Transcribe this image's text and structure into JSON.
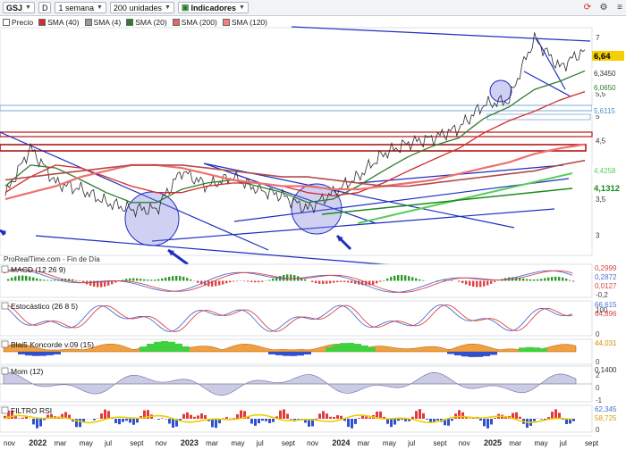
{
  "toolbar": {
    "ticker": "GSJ",
    "period_button": "D",
    "timeframe": "1 semana",
    "units": "200 unidades",
    "indicators_label": "Indicadores"
  },
  "legend": [
    {
      "label": "Precio",
      "color": "#ffffff"
    },
    {
      "label": "SMA (40)",
      "color": "#d42b2b"
    },
    {
      "label": "SMA (4)",
      "color": "#9a9a9a"
    },
    {
      "label": "SMA (20)",
      "color": "#2f7d2f"
    },
    {
      "label": "SMA (200)",
      "color": "#d96b6b"
    },
    {
      "label": "SMA (120)",
      "color": "#f08080"
    }
  ],
  "price_axis": {
    "ticks": [
      "7",
      "6,5",
      "6",
      "5,5",
      "5",
      "4,5",
      "4",
      "3,5",
      "3"
    ],
    "badges": [
      {
        "text": "6,64",
        "bg": "#f4d000",
        "fg": "#000000",
        "bold": true
      },
      {
        "text": "6,3450",
        "bg": "#ffffff",
        "fg": "#333333",
        "bold": false
      },
      {
        "text": "6,0650",
        "bg": "#ffffff",
        "fg": "#2f7d2f",
        "bold": false
      },
      {
        "text": "5,6115",
        "bg": "#ffffff",
        "fg": "#4d8fd0",
        "bold": false
      },
      {
        "text": "4,4258",
        "bg": "#ffffff",
        "fg": "#5ccc5c",
        "bold": false
      },
      {
        "text": "4,1312",
        "bg": "#ffffff",
        "fg": "#1a8a1a",
        "bold": true
      }
    ]
  },
  "watermark": "ProRealTime.com - Fin de Día",
  "x_axis": {
    "labels": [
      "nov",
      "2022",
      "mar",
      "may",
      "jul",
      "sept",
      "nov",
      "2023",
      "mar",
      "may",
      "jul",
      "sept",
      "nov",
      "2024",
      "mar",
      "may",
      "jul",
      "sept",
      "nov",
      "2025",
      "mar",
      "may",
      "jul",
      "sept"
    ],
    "bold": [
      "2022",
      "2023",
      "2024",
      "2025"
    ]
  },
  "panels": [
    {
      "key": "macd",
      "title": "MACD (12 26 9)",
      "values": [
        "0,2999",
        "0,2872",
        "0,0127"
      ],
      "value_colors": [
        "#d44",
        "#4a6fd0",
        "#d44"
      ],
      "ticks": [
        "-0,2"
      ]
    },
    {
      "key": "stoch",
      "title": "Estocástico (26 8 5)",
      "values": [
        "66,615",
        "64,896"
      ],
      "value_colors": [
        "#4a6fd0",
        "#d44"
      ],
      "ticks": [
        "100",
        "0"
      ]
    },
    {
      "key": "blai5",
      "title": "Blai5 Koncorde v.09 (15)",
      "values": [
        "44,031"
      ],
      "value_colors": [
        "#d88a00"
      ],
      "ticks": [
        "0"
      ]
    },
    {
      "key": "mom",
      "title": "Mom (12)",
      "values": [
        "0,1400"
      ],
      "value_colors": [
        "#333333"
      ],
      "ticks": [
        "2",
        "0",
        "-1"
      ]
    },
    {
      "key": "rsi",
      "title": "FILTRO RSI",
      "values": [
        "62,345",
        "58,725"
      ],
      "value_colors": [
        "#4a6fd0",
        "#d4a000"
      ],
      "ticks": [
        "0"
      ]
    }
  ],
  "chart_data": {
    "type": "line",
    "title": "GSJ",
    "x": [
      "2021-11",
      "2022-01",
      "2022-03",
      "2022-05",
      "2022-07",
      "2022-09",
      "2022-11",
      "2023-01",
      "2023-03",
      "2023-05",
      "2023-07",
      "2023-09",
      "2023-11",
      "2024-01",
      "2024-03",
      "2024-05",
      "2024-07",
      "2024-09",
      "2024-11",
      "2025-01",
      "2025-03",
      "2025-05",
      "2025-07",
      "2025-08"
    ],
    "series": [
      {
        "name": "Precio",
        "values": [
          3.55,
          4.35,
          3.75,
          3.65,
          3.45,
          3.35,
          3.35,
          3.95,
          3.7,
          3.85,
          3.65,
          3.55,
          3.35,
          3.6,
          3.85,
          4.25,
          4.45,
          4.55,
          4.75,
          5.25,
          5.35,
          6.95,
          6.15,
          6.64
        ]
      },
      {
        "name": "SMA (20)",
        "values": [
          3.7,
          4.05,
          4.0,
          3.8,
          3.6,
          3.45,
          3.45,
          3.65,
          3.75,
          3.8,
          3.7,
          3.6,
          3.45,
          3.5,
          3.7,
          3.95,
          4.2,
          4.4,
          4.55,
          4.95,
          5.2,
          5.6,
          5.8,
          6.065
        ]
      },
      {
        "name": "SMA (40)",
        "values": [
          3.6,
          3.85,
          4.05,
          4.0,
          3.85,
          3.7,
          3.6,
          3.6,
          3.7,
          3.75,
          3.75,
          3.7,
          3.6,
          3.55,
          3.6,
          3.75,
          3.95,
          4.15,
          4.35,
          4.65,
          4.9,
          5.1,
          5.35,
          5.55
        ]
      },
      {
        "name": "SMA (120)",
        "values": [
          3.5,
          3.6,
          3.7,
          3.85,
          3.95,
          4.05,
          4.05,
          4.0,
          3.9,
          3.8,
          3.75,
          3.7,
          3.7,
          3.65,
          3.65,
          3.7,
          3.75,
          3.8,
          3.9,
          4.0,
          4.1,
          4.25,
          4.35,
          4.4258
        ]
      },
      {
        "name": "SMA (200)",
        "values": [
          3.8,
          3.85,
          3.9,
          3.95,
          4.0,
          4.05,
          4.05,
          4.05,
          4.0,
          3.95,
          3.9,
          3.85,
          3.85,
          3.8,
          3.75,
          3.7,
          3.7,
          3.75,
          3.8,
          3.85,
          3.9,
          3.95,
          4.05,
          4.1312
        ]
      }
    ],
    "ylim": [
      2.75,
      7.3
    ],
    "yscale": "log",
    "grid": false
  }
}
